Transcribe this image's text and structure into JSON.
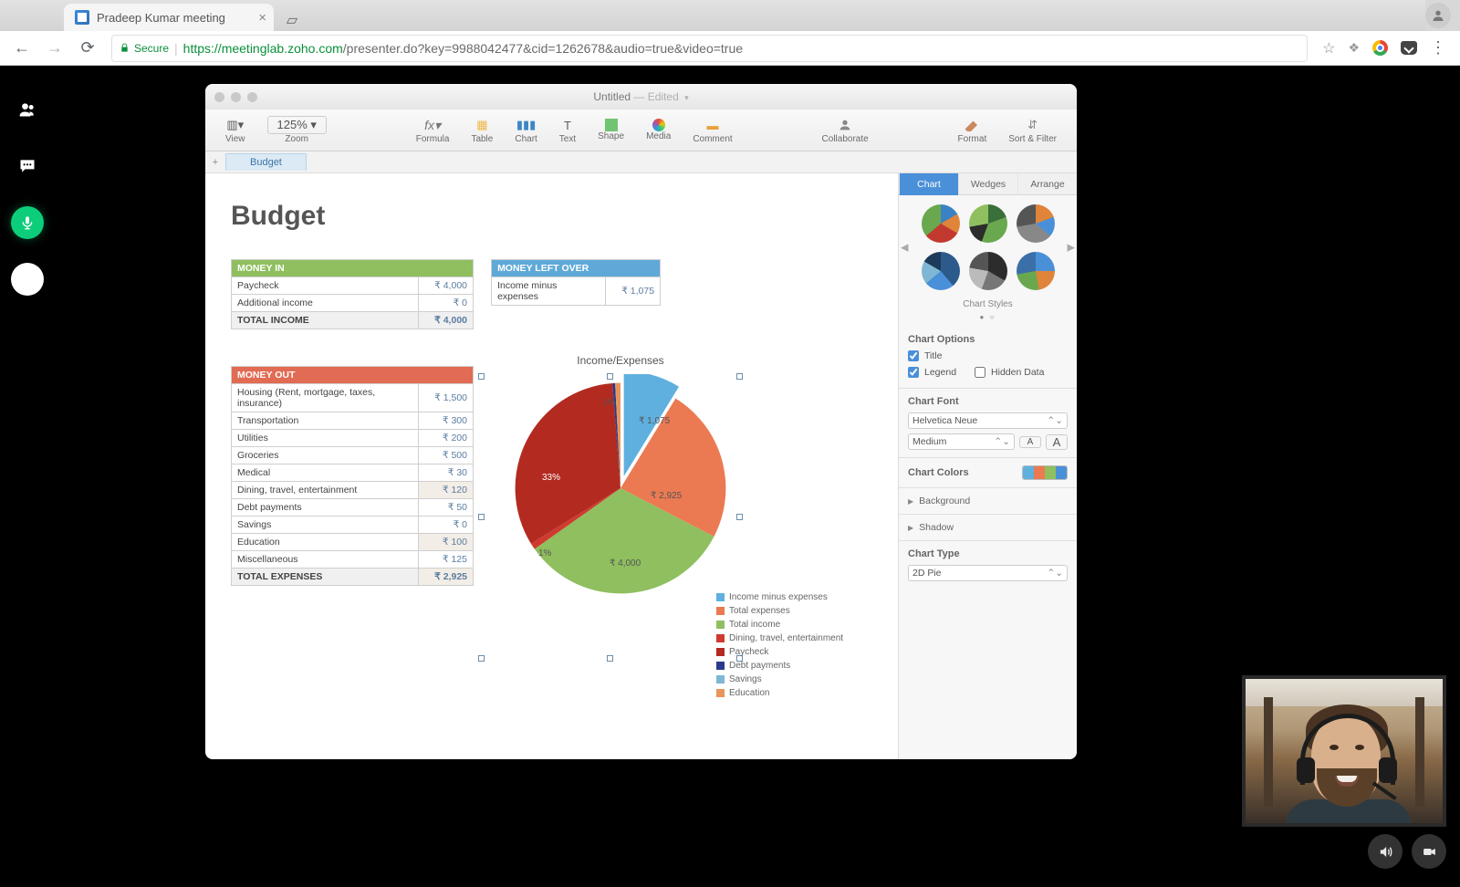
{
  "browser": {
    "tab_title": "Pradeep Kumar meeting",
    "secure_label": "Secure",
    "url_origin": "https://meetinglab.zoho.com",
    "url_path": "/presenter.do?key=9988042477&cid=1262678&audio=true&video=true"
  },
  "meeting_sidebar": {
    "items": [
      "participants",
      "chat",
      "microphone",
      "record"
    ]
  },
  "numbers": {
    "window_title": "Untitled",
    "window_state": "Edited",
    "zoom": "125%",
    "toolbar": [
      {
        "id": "view",
        "label": "View"
      },
      {
        "id": "zoom",
        "label": "Zoom"
      },
      {
        "id": "formula",
        "label": "Formula"
      },
      {
        "id": "table",
        "label": "Table"
      },
      {
        "id": "chart",
        "label": "Chart"
      },
      {
        "id": "text",
        "label": "Text"
      },
      {
        "id": "shape",
        "label": "Shape"
      },
      {
        "id": "media",
        "label": "Media"
      },
      {
        "id": "comment",
        "label": "Comment"
      },
      {
        "id": "collaborate",
        "label": "Collaborate"
      },
      {
        "id": "format",
        "label": "Format"
      },
      {
        "id": "sort",
        "label": "Sort & Filter"
      }
    ],
    "sheet_tab": "Budget",
    "doc_title": "Budget",
    "money_in": {
      "header": "MONEY IN",
      "rows": [
        {
          "label": "Paycheck",
          "value": "₹ 4,000"
        },
        {
          "label": "Additional income",
          "value": "₹ 0"
        }
      ],
      "total_label": "TOTAL INCOME",
      "total_value": "₹ 4,000"
    },
    "money_left": {
      "header": "MONEY LEFT OVER",
      "rows": [
        {
          "label": "Income minus expenses",
          "value": "₹ 1,075"
        }
      ]
    },
    "money_out": {
      "header": "MONEY OUT",
      "rows": [
        {
          "label": "Housing (Rent, mortgage, taxes, insurance)",
          "value": "₹ 1,500"
        },
        {
          "label": "Transportation",
          "value": "₹ 300"
        },
        {
          "label": "Utilities",
          "value": "₹ 200"
        },
        {
          "label": "Groceries",
          "value": "₹ 500"
        },
        {
          "label": "Medical",
          "value": "₹ 30"
        },
        {
          "label": "Dining, travel, entertainment",
          "value": "₹ 120",
          "sep": true
        },
        {
          "label": "Debt payments",
          "value": "₹ 50"
        },
        {
          "label": "Savings",
          "value": "₹ 0"
        },
        {
          "label": "Education",
          "value": "₹ 100",
          "sep": true
        },
        {
          "label": "Miscellaneous",
          "value": "₹ 125"
        }
      ],
      "total_label": "TOTAL EXPENSES",
      "total_value": "₹ 2,925"
    },
    "pie_title": "Income/Expenses",
    "pie_labels": {
      "a": "₹ 1,075",
      "b": "₹ 2,925",
      "c": "₹ 4,000",
      "d": "33%",
      "e": "1%",
      "f": "1%"
    },
    "legend": [
      {
        "color": "#5fb0df",
        "label": "Income minus expenses"
      },
      {
        "color": "#eb7a52",
        "label": "Total expenses"
      },
      {
        "color": "#8fbf5f",
        "label": "Total income"
      },
      {
        "color": "#cf3a2f",
        "label": "Dining, travel, entertainment"
      },
      {
        "color": "#b32b20",
        "label": "Paycheck"
      },
      {
        "color": "#2a3a8a",
        "label": "Debt payments"
      },
      {
        "color": "#7fb6d4",
        "label": "Savings"
      },
      {
        "color": "#e8955c",
        "label": "Education"
      }
    ],
    "inspector": {
      "tabs": [
        "Chart",
        "Wedges",
        "Arrange"
      ],
      "styles_caption": "Chart Styles",
      "sections": {
        "options_header": "Chart Options",
        "title_opt": "Title",
        "legend_opt": "Legend",
        "hidden_opt": "Hidden Data",
        "font_header": "Chart Font",
        "font_family": "Helvetica Neue",
        "font_weight": "Medium",
        "colors_header": "Chart Colors",
        "background": "Background",
        "shadow": "Shadow",
        "type_header": "Chart Type",
        "type_value": "2D Pie"
      }
    }
  },
  "chart_data": {
    "type": "pie",
    "title": "Income/Expenses",
    "series": [
      {
        "name": "Income minus expenses",
        "value": 1075,
        "color": "#5fb0df"
      },
      {
        "name": "Total expenses",
        "value": 2925,
        "color": "#eb7a52"
      },
      {
        "name": "Total income",
        "value": 4000,
        "color": "#8fbf5f"
      },
      {
        "name": "Dining, travel, entertainment",
        "value": 120,
        "color": "#cf3a2f"
      },
      {
        "name": "Paycheck",
        "value": 4000,
        "color": "#b32b20"
      },
      {
        "name": "Debt payments",
        "value": 50,
        "color": "#2a3a8a"
      },
      {
        "name": "Savings",
        "value": 0,
        "color": "#7fb6d4"
      },
      {
        "name": "Education",
        "value": 100,
        "color": "#e8955c"
      }
    ]
  },
  "video_controls": [
    "speaker",
    "camera"
  ]
}
